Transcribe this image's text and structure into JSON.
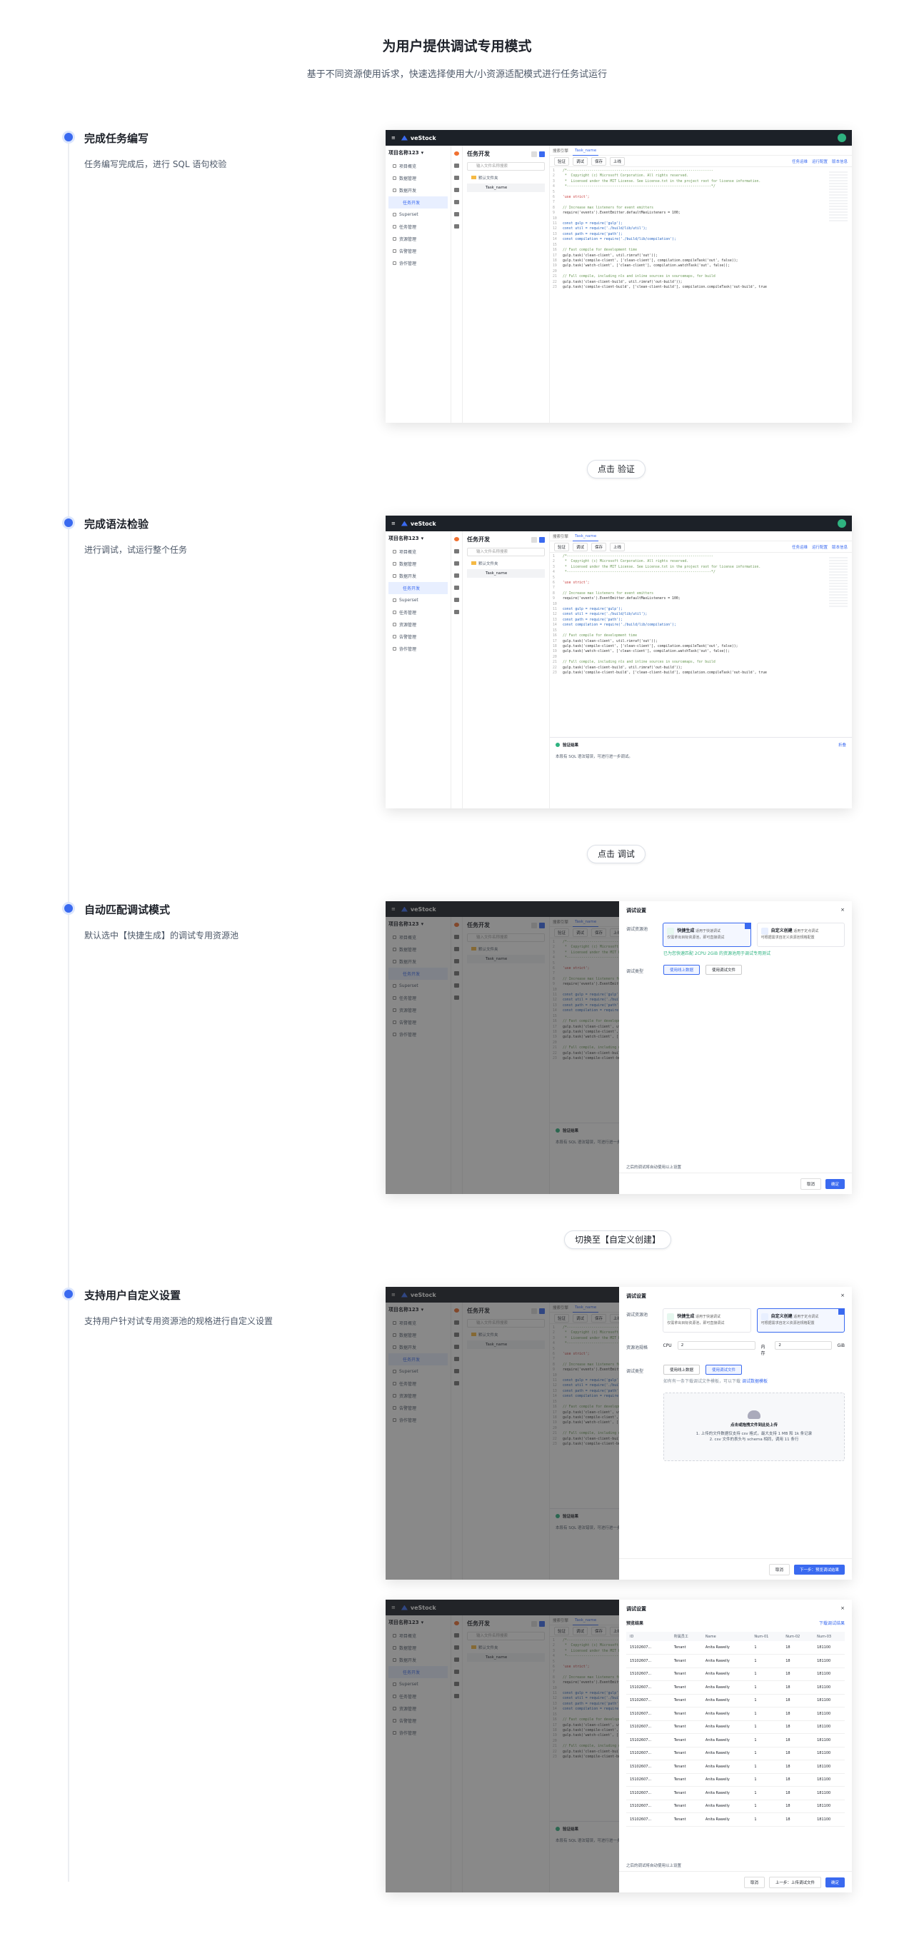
{
  "header": {
    "title": "为用户提供调试专用模式",
    "subtitle": "基于不同资源使用诉求，快速选择使用大/小资源适配模式进行任务试运行"
  },
  "steps": [
    {
      "title": "完成任务编写",
      "desc": "任务编写完成后，进行 SQL 语句校验"
    },
    {
      "title": "完成语法检验",
      "desc": "进行调试，试运行整个任务"
    },
    {
      "title": "自动匹配调试模式",
      "desc": "默认选中【快捷生成】的调试专用资源池"
    },
    {
      "title": "支持用户自定义设置",
      "desc": "支持用户针对试专用资源池的规格进行自定义设置"
    }
  ],
  "pills": [
    "点击 验证",
    "点击 调试",
    "切换至【自定义创建】"
  ],
  "app": {
    "brand": "veStock",
    "project": "项目名称123",
    "nav": [
      "项目概览",
      "数据管理",
      "数据开发",
      "任务开发",
      "Superset",
      "任务管理",
      "资源管理",
      "告警管理",
      "协作管理"
    ],
    "tree_title": "任务开发",
    "search_placeholder": "输入文件名称搜索",
    "folder": "默认文件夹",
    "file": "Task_name",
    "tabs": [
      "搜索引擎",
      "Task_name"
    ],
    "toolbar": [
      "验证",
      "调试",
      "保存",
      "上线"
    ],
    "toolbar_right": [
      "任务运维",
      "运行配置",
      "版本信息"
    ],
    "code": [
      {
        "n": "1",
        "t": "/*-----------------------------------------------------------------------",
        "c": "c"
      },
      {
        "n": "2",
        "t": " *  Copyright (c) Microsoft Corporation. All rights reserved.",
        "c": "c"
      },
      {
        "n": "3",
        "t": " *  Licensed under the MIT License. See License.txt in the project root for license information.",
        "c": "c"
      },
      {
        "n": "4",
        "t": " *----------------------------------------------------------------------*/",
        "c": "c"
      },
      {
        "n": "5",
        "t": "",
        "c": ""
      },
      {
        "n": "6",
        "t": "'use strict';",
        "c": "s"
      },
      {
        "n": "7",
        "t": "",
        "c": ""
      },
      {
        "n": "8",
        "t": "// Increase max listeners for event emitters",
        "c": "c"
      },
      {
        "n": "9",
        "t": "require('events').EventEmitter.defaultMaxListeners = 100;",
        "c": ""
      },
      {
        "n": "10",
        "t": "",
        "c": ""
      },
      {
        "n": "11",
        "t": "const gulp = require('gulp');",
        "c": "k"
      },
      {
        "n": "12",
        "t": "const util = require('./build/lib/util');",
        "c": "k"
      },
      {
        "n": "13",
        "t": "const path = require('path');",
        "c": "k"
      },
      {
        "n": "14",
        "t": "const compilation = require('./build/lib/compilation');",
        "c": "k"
      },
      {
        "n": "15",
        "t": "",
        "c": ""
      },
      {
        "n": "16",
        "t": "// Fast compile for development time",
        "c": "c"
      },
      {
        "n": "17",
        "t": "gulp.task('clean-client', util.rimraf('out'));",
        "c": ""
      },
      {
        "n": "18",
        "t": "gulp.task('compile-client', ['clean-client'], compilation.compileTask('out', false));",
        "c": ""
      },
      {
        "n": "19",
        "t": "gulp.task('watch-client', ['clean-client'], compilation.watchTask('out', false));",
        "c": ""
      },
      {
        "n": "20",
        "t": "",
        "c": ""
      },
      {
        "n": "21",
        "t": "// Full compile, including nls and inline sources in sourcemaps, for build",
        "c": "c"
      },
      {
        "n": "22",
        "t": "gulp.task('clean-client-build', util.rimraf('out-build'));",
        "c": ""
      },
      {
        "n": "23",
        "t": "gulp.task('compile-client-build', ['clean-client-build'], compilation.compileTask('out-build', true",
        "c": ""
      }
    ],
    "result": {
      "title": "验证结果",
      "close": "折叠",
      "text": "本段有 SQL 语法错误，可进行进一步调试。"
    }
  },
  "modal": {
    "title": "调试设置",
    "close": "×",
    "res_label": "调试资源池",
    "quick": {
      "title": "快捷生成",
      "tag": "适用于快速调试",
      "desc": "仅需拿出目标资源池，即可直接调试"
    },
    "custom": {
      "title": "自定义创建",
      "tag": "适用于定点调试",
      "desc": "可根据需求自定义资源池规格配置"
    },
    "hint": "已为您快速匹配 2CPU 2GiB 的资源池用于调试专用测试",
    "type_label": "调试类型",
    "type_opts": [
      "使用线上数据",
      "使用调试文件"
    ],
    "spec_label": "资源池规格",
    "cpu_label": "CPU",
    "cpu_val": "2",
    "mem_label": "内存",
    "mem_val": "2",
    "mem_unit": "GiB",
    "file_hint": "如有有一条下载调试文件模板，可以下载",
    "file_link": "调试数据模板",
    "upload_title": "点击或拖拽文件到此处上传",
    "upload_sub1": "1. 上传的文件数据仅支持 csv 格式，最大支持 1 MB 和 1k 条记录",
    "upload_sub2": "2. csv 文件的表头与 schema 相同，调用 11 条行",
    "note": "之后的调试将自动使用以上设置",
    "cancel": "取消",
    "confirm": "确定",
    "next": "下一步：预览调试结果",
    "prev": "上一步：上传调试文件",
    "preview_title": "预览结果",
    "download": "下载调试结果",
    "cols": [
      "ID",
      "所属员工",
      "Name",
      "Num-01",
      "Num-02",
      "Num-03"
    ],
    "rows": [
      [
        "15102607...",
        "Tenant",
        "Anita Rawelly",
        "1",
        "18",
        "181100"
      ],
      [
        "15102607...",
        "Tenant",
        "Anita Rawelly",
        "1",
        "18",
        "181100"
      ],
      [
        "15102607...",
        "Tenant",
        "Anita Rawelly",
        "1",
        "18",
        "181100"
      ],
      [
        "15102607...",
        "Tenant",
        "Anita Rawelly",
        "1",
        "18",
        "181100"
      ],
      [
        "15102607...",
        "Tenant",
        "Anita Rawelly",
        "1",
        "18",
        "181100"
      ],
      [
        "15102607...",
        "Tenant",
        "Anita Rawelly",
        "1",
        "18",
        "181100"
      ],
      [
        "15102607...",
        "Tenant",
        "Anita Rawelly",
        "1",
        "18",
        "181100"
      ],
      [
        "15102607...",
        "Tenant",
        "Anita Rawelly",
        "1",
        "18",
        "181100"
      ],
      [
        "15102607...",
        "Tenant",
        "Anita Rawelly",
        "1",
        "18",
        "181100"
      ],
      [
        "15102607...",
        "Tenant",
        "Anita Rawelly",
        "1",
        "18",
        "181100"
      ],
      [
        "15102607...",
        "Tenant",
        "Anita Rawelly",
        "1",
        "18",
        "181100"
      ],
      [
        "15102607...",
        "Tenant",
        "Anita Rawelly",
        "1",
        "18",
        "181100"
      ],
      [
        "15102607...",
        "Tenant",
        "Anita Rawelly",
        "1",
        "18",
        "181100"
      ],
      [
        "15102607...",
        "Tenant",
        "Anita Rawelly",
        "1",
        "18",
        "181100"
      ]
    ]
  }
}
